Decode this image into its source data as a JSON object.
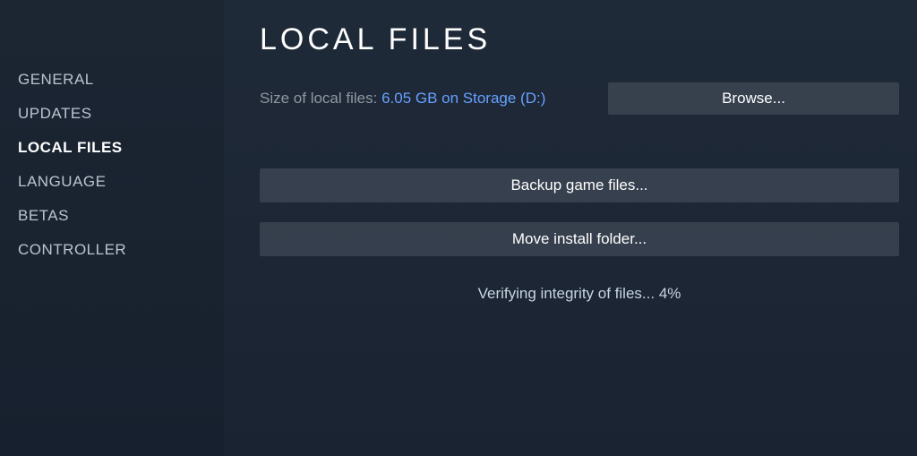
{
  "sidebar": {
    "items": [
      {
        "label": "GENERAL",
        "active": false
      },
      {
        "label": "UPDATES",
        "active": false
      },
      {
        "label": "LOCAL FILES",
        "active": true
      },
      {
        "label": "LANGUAGE",
        "active": false
      },
      {
        "label": "BETAS",
        "active": false
      },
      {
        "label": "CONTROLLER",
        "active": false
      }
    ]
  },
  "main": {
    "title": "LOCAL FILES",
    "size_label": "Size of local files: ",
    "size_value": "6.05 GB on Storage (D:)",
    "browse_label": "Browse...",
    "backup_label": "Backup game files...",
    "move_label": "Move install folder...",
    "status_prefix": "Verifying integrity of files... ",
    "status_percent": "4%"
  }
}
